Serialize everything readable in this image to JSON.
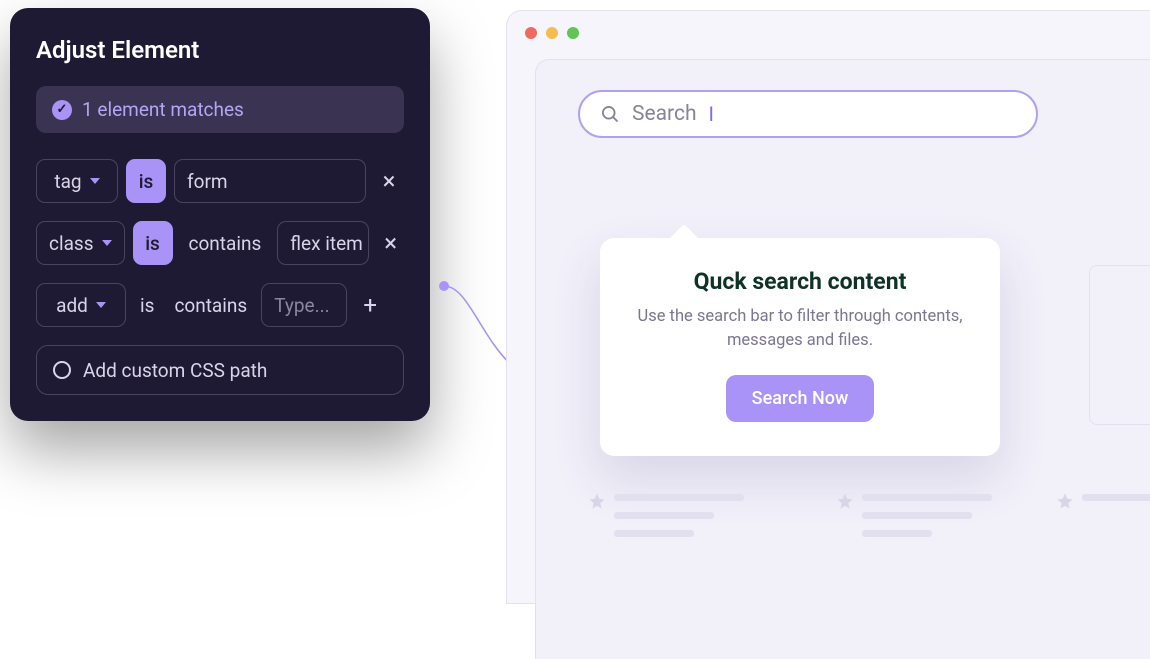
{
  "panel": {
    "title": "Adjust Element",
    "match_status": "1 element matches",
    "rules": [
      {
        "attr": "tag",
        "op": "is",
        "op_style": "solid",
        "match": null,
        "value": "form",
        "action": "remove"
      },
      {
        "attr": "class",
        "op": "is",
        "op_style": "solid",
        "match": "contains",
        "value": "flex item",
        "action": "remove"
      },
      {
        "attr": "add",
        "op": "is",
        "op_style": "plain",
        "match": "contains",
        "value": "Type...",
        "action": "add"
      }
    ],
    "custom_label": "Add custom CSS path"
  },
  "browser": {
    "search_placeholder": "Search",
    "popover": {
      "title": "Quck search content",
      "desc": "Use the search bar to filter through contents, messages and files.",
      "button": "Search Now"
    }
  }
}
